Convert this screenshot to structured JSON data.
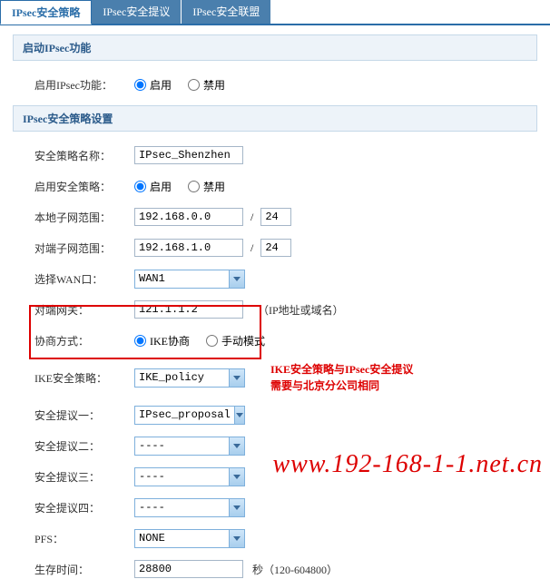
{
  "tabs": [
    {
      "label": "IPsec安全策略",
      "active": true
    },
    {
      "label": "IPsec安全提议",
      "active": false
    },
    {
      "label": "IPsec安全联盟",
      "active": false
    }
  ],
  "section1": {
    "title": "启动IPsec功能",
    "enable_label": "启用IPsec功能：",
    "radio_on": "启用",
    "radio_off": "禁用"
  },
  "section2": {
    "title": "IPsec安全策略设置",
    "policy_name_label": "安全策略名称：",
    "policy_name_value": "IPsec_Shenzhen",
    "enable_policy_label": "启用安全策略：",
    "radio_on": "启用",
    "radio_off": "禁用",
    "local_subnet_label": "本地子网范围：",
    "local_subnet_value": "192.168.0.0",
    "local_mask_value": "24",
    "remote_subnet_label": "对端子网范围：",
    "remote_subnet_value": "192.168.1.0",
    "remote_mask_value": "24",
    "wan_label": "选择WAN口：",
    "wan_value": "WAN1",
    "gateway_label": "对端网关：",
    "gateway_value": "121.1.1.2",
    "gateway_hint": "（IP地址或域名）",
    "negotiate_label": "协商方式：",
    "negotiate_ike": "IKE协商",
    "negotiate_manual": "手动模式",
    "ike_policy_label": "IKE安全策略：",
    "ike_policy_value": "IKE_policy",
    "proposal1_label": "安全提议一：",
    "proposal1_value": "IPsec_proposal",
    "proposal2_label": "安全提议二：",
    "proposal2_value": "----",
    "proposal3_label": "安全提议三：",
    "proposal3_value": "----",
    "proposal4_label": "安全提议四：",
    "proposal4_value": "----",
    "pfs_label": "PFS：",
    "pfs_value": "NONE",
    "lifetime_label": "生存时间：",
    "lifetime_value": "28800",
    "lifetime_hint": "秒（120-604800）"
  },
  "annotation": {
    "line1": "IKE安全策略与IPsec安全提议",
    "line2": "需要与北京分公司相同"
  },
  "watermark": "www.192-168-1-1.net.cn"
}
